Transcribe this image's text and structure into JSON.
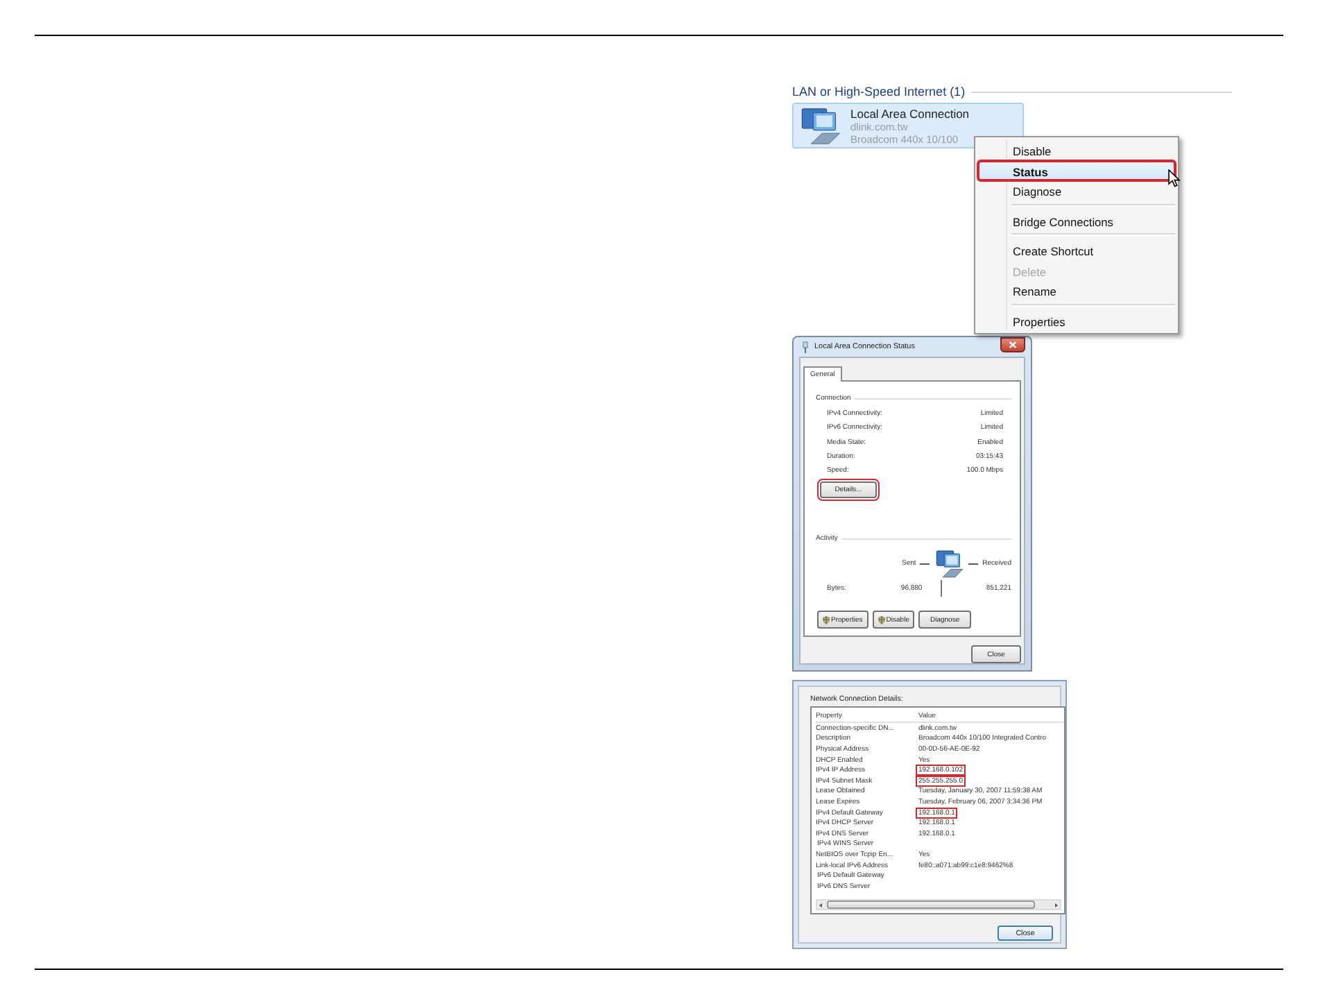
{
  "network_window": {
    "group_header": "LAN or High-Speed Internet (1)",
    "connection": {
      "name": "Local Area Connection",
      "domain": "dlink.com.tw",
      "adapter": "Broadcom 440x 10/100",
      "selected": true
    },
    "context_menu": {
      "groups": [
        [
          {
            "label": "Disable",
            "selected": false,
            "default": false,
            "disabled": false,
            "highlighted": false
          },
          {
            "label": "Status",
            "selected": true,
            "default": true,
            "disabled": false,
            "highlighted": true
          },
          {
            "label": "Diagnose",
            "selected": false,
            "default": false,
            "disabled": false,
            "highlighted": false
          }
        ],
        [
          {
            "label": "Bridge Connections",
            "selected": false,
            "default": false,
            "disabled": false,
            "highlighted": false
          }
        ],
        [
          {
            "label": "Create Shortcut",
            "selected": false,
            "default": false,
            "disabled": false,
            "highlighted": false
          },
          {
            "label": "Delete",
            "selected": false,
            "default": false,
            "disabled": true,
            "highlighted": false
          },
          {
            "label": "Rename",
            "selected": false,
            "default": false,
            "disabled": false,
            "highlighted": false
          }
        ],
        [
          {
            "label": "Properties",
            "selected": false,
            "default": false,
            "disabled": false,
            "highlighted": false
          }
        ]
      ]
    }
  },
  "status_dialog": {
    "title": "Local Area Connection Status",
    "tabs": [
      {
        "label": "General",
        "selected": true
      }
    ],
    "connection": {
      "heading": "Connection",
      "rows": [
        {
          "label": "IPv4 Connectivity:",
          "value": "Limited"
        },
        {
          "label": "IPv6 Connectivity:",
          "value": "Limited"
        },
        {
          "label": "Media State:",
          "value": "Enabled"
        },
        {
          "label": "Duration:",
          "value": "03:15:43"
        },
        {
          "label": "Speed:",
          "value": "100.0 Mbps"
        }
      ],
      "details_button": {
        "label": "Details...",
        "highlighted": true
      }
    },
    "activity": {
      "heading": "Activity",
      "sent_label": "Sent",
      "received_label": "Received",
      "bytes_label": "Bytes:",
      "bytes_sent": "96,880",
      "bytes_received": "851,221"
    },
    "buttons": [
      {
        "label": "Properties",
        "kind": "shield"
      },
      {
        "label": "Disable",
        "kind": "shield"
      },
      {
        "label": "Diagnose",
        "kind": "plain"
      }
    ],
    "close_button": "Close"
  },
  "details_dialog": {
    "caption": "Network Connection Details:",
    "columns": [
      "Property",
      "Value"
    ],
    "rows": [
      {
        "property": "Connection-specific DN...",
        "value": "dlink.com.tw",
        "highlighted": false
      },
      {
        "property": "Description",
        "value": "Broadcom 440x 10/100 Integrated Contro",
        "highlighted": false
      },
      {
        "property": "Physical Address",
        "value": "00-0D-56-AE-0E-92",
        "highlighted": false
      },
      {
        "property": "DHCP Enabled",
        "value": "Yes",
        "highlighted": false
      },
      {
        "property": "IPv4 IP Address",
        "value": "192.168.0.102",
        "highlighted": true
      },
      {
        "property": "IPv4 Subnet Mask",
        "value": "255.255.255.0",
        "highlighted": true
      },
      {
        "property": "Lease Obtained",
        "value": "Tuesday, January 30, 2007 11:59:38 AM",
        "highlighted": false
      },
      {
        "property": "Lease Expires",
        "value": "Tuesday, February 06, 2007 3:34:36 PM",
        "highlighted": false
      },
      {
        "property": "IPv4 Default Gateway",
        "value": "192.168.0.1",
        "highlighted": true
      },
      {
        "property": "IPv4 DHCP Server",
        "value": "192.168.0.1",
        "highlighted": false
      },
      {
        "property": "IPv4 DNS Server",
        "value": "192.168.0.1",
        "highlighted": false
      },
      {
        "property": "IPv4 WINS Server",
        "highlighted": false
      },
      {
        "property": "NetBIOS over Tcpip En...",
        "value": "Yes",
        "highlighted": false
      },
      {
        "property": "Link-local IPv6 Address",
        "value": "fe80::a071:ab99:c1e8:9462%8",
        "highlighted": false
      },
      {
        "property": "IPv6 Default Gateway",
        "highlighted": false
      },
      {
        "property": "IPv6 DNS Server",
        "highlighted": false
      }
    ],
    "close_button": "Close"
  }
}
